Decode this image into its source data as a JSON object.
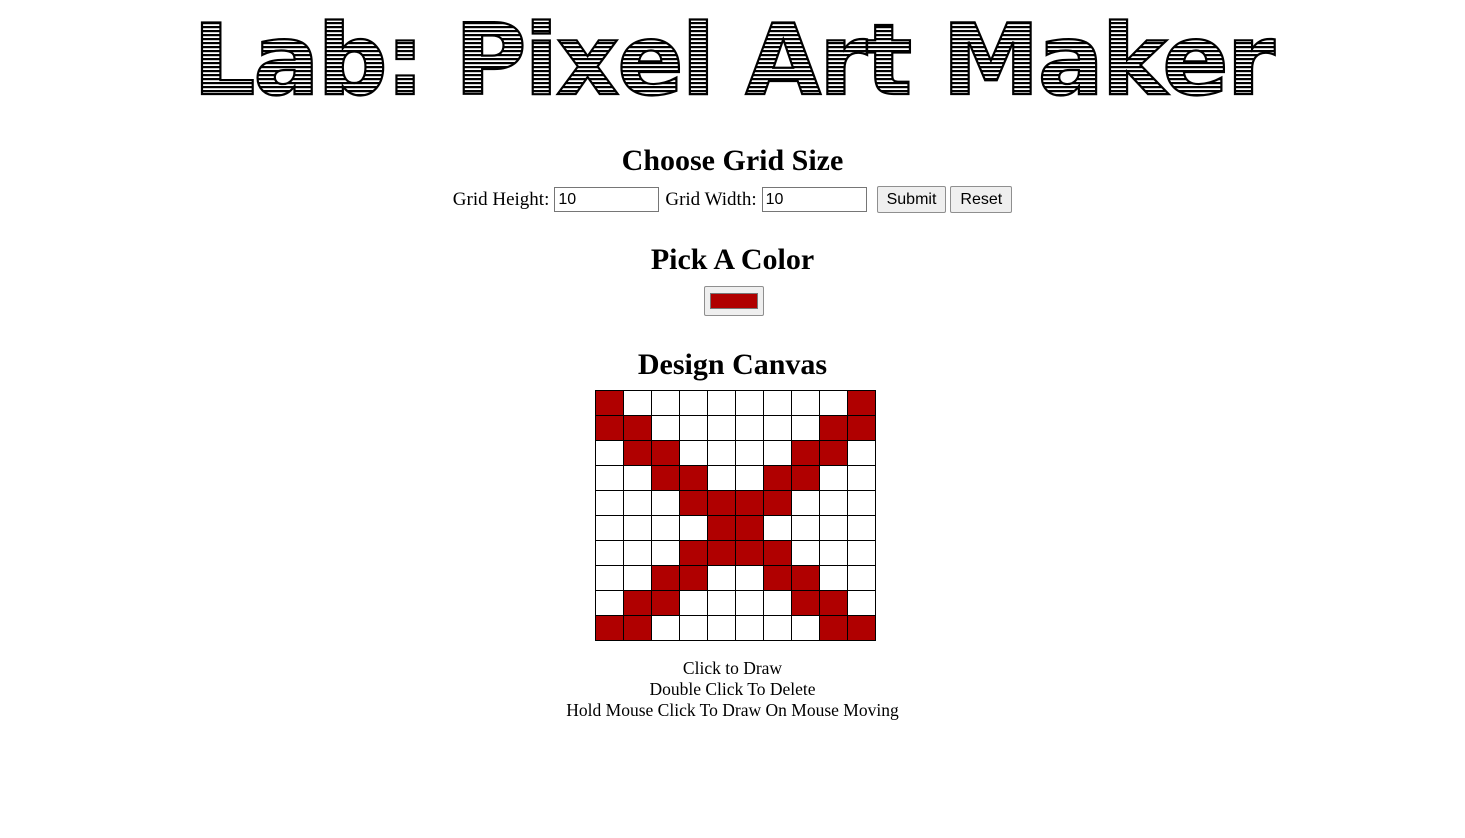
{
  "title": "Lab: Pixel Art Maker",
  "grid_section": {
    "heading": "Choose Grid Size",
    "height_label": "Grid Height:",
    "height_value": "10",
    "width_label": "Grid Width:",
    "width_value": "10",
    "submit_label": "Submit",
    "reset_label": "Reset"
  },
  "color_section": {
    "heading": "Pick A Color",
    "selected_color": "#b00000"
  },
  "canvas_section": {
    "heading": "Design Canvas",
    "rows": 10,
    "cols": 10,
    "fill_color": "#b00000",
    "pattern": [
      "1000000001",
      "1100000011",
      "0110000110",
      "0011001100",
      "0001111000",
      "0000110000",
      "0001111000",
      "0011001100",
      "0110000110",
      "1100000011"
    ]
  },
  "instructions": [
    "Click to Draw",
    "Double Click To Delete",
    "Hold Mouse Click To Draw On Mouse Moving"
  ]
}
